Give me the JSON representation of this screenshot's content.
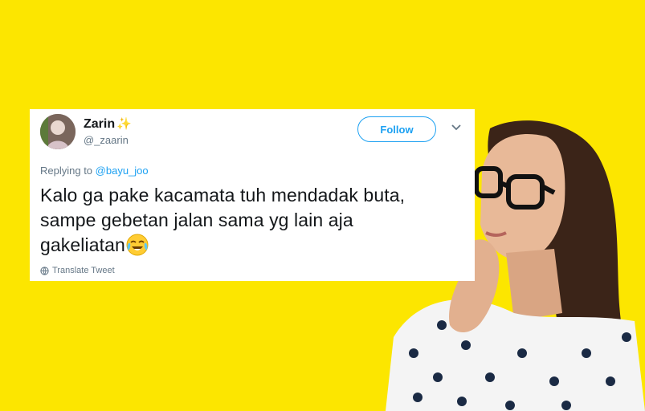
{
  "tweet": {
    "display_name": "Zarin",
    "handle": "@_zaarin",
    "follow_label": "Follow",
    "reply_prefix": "Replying to",
    "reply_to": "@bayu_joo",
    "text_line1": "Kalo ga pake kacamata tuh mendadak buta,",
    "text_line2": "sampe gebetan jalan sama yg lain aja",
    "text_line3": "gakeliatan",
    "translate_label": "Translate Tweet"
  },
  "icons": {
    "sparkle": "sparkles-icon",
    "caret": "chevron-down-icon",
    "emoji": "face-with-tears-of-joy-icon",
    "globe": "globe-icon"
  },
  "colors": {
    "background": "#fce600",
    "twitter_blue": "#1da1f2",
    "secondary_text": "#657786"
  }
}
